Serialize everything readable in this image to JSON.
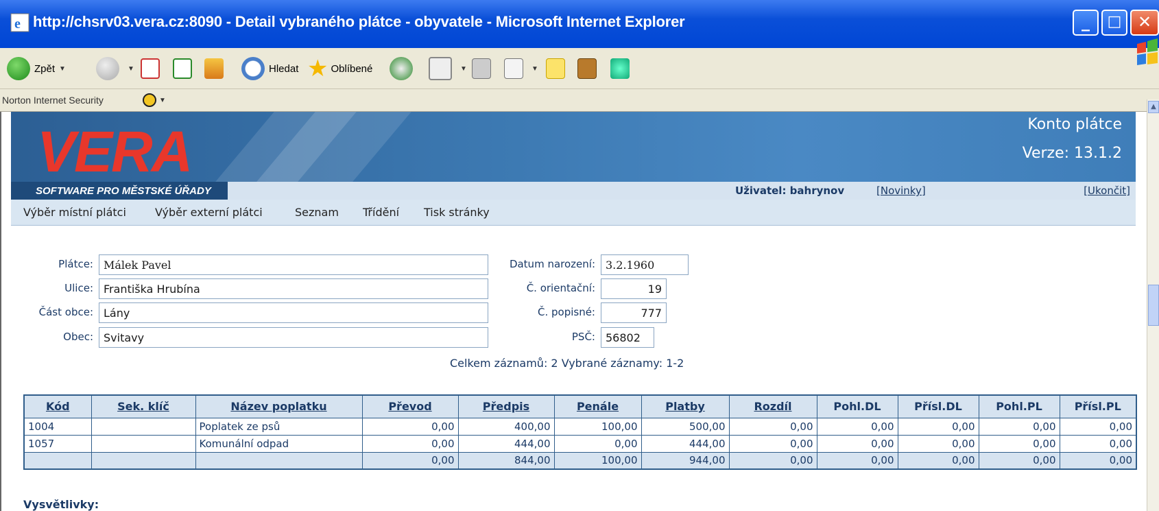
{
  "window": {
    "title": "http://chsrv03.vera.cz:8090 - Detail vybraného plátce - obyvatele - Microsoft Internet Explorer",
    "minimize": "_",
    "maximize": "□",
    "close": "✕"
  },
  "toolbar": {
    "back": "Zpět",
    "search": "Hledat",
    "favorites": "Oblíbené"
  },
  "norton": {
    "label": "Norton Internet Security"
  },
  "header": {
    "logo": "VERA",
    "tagline": "SOFTWARE PRO MĚSTSKÉ ÚŘADY",
    "module": "Konto plátce",
    "version": "Verze: 13.1.2",
    "user": "Uživatel: bahrynov",
    "news": "[Novinky]",
    "logout": "[Ukončit]"
  },
  "menu": [
    "Výběr místní plátci",
    "Výběr externí plátci",
    "Seznam",
    "Třídění",
    "Tisk stránky"
  ],
  "form": {
    "platce_label": "Plátce:",
    "platce": "Málek Pavel",
    "ulice_label": "Ulice:",
    "ulice": "Františka Hrubína",
    "cast_label": "Část obce:",
    "cast": "Lány",
    "obec_label": "Obec:",
    "obec": "Svitavy",
    "datum_label": "Datum narození:",
    "datum": "3.2.1960",
    "orient_label": "Č. orientační:",
    "orient": "19",
    "popis_label": "Č. popisné:",
    "popis": "777",
    "psc_label": "PSČ:",
    "psc": "56802"
  },
  "summary": "Celkem záznamů: 2 Vybrané záznamy: 1-2",
  "table": {
    "headers": [
      "Kód",
      "Sek. klíč",
      "Název poplatku",
      "Převod",
      "Předpis",
      "Penále",
      "Platby",
      "Rozdíl",
      "Pohl.DL",
      "Přísl.DL",
      "Pohl.PL",
      "Přísl.PL"
    ],
    "rows": [
      [
        "1004",
        "",
        "Poplatek ze psů",
        "0,00",
        "400,00",
        "100,00",
        "500,00",
        "0,00",
        "0,00",
        "0,00",
        "0,00",
        "0,00"
      ],
      [
        "1057",
        "",
        "Komunální odpad",
        "0,00",
        "444,00",
        "0,00",
        "444,00",
        "0,00",
        "0,00",
        "0,00",
        "0,00",
        "0,00"
      ],
      [
        "",
        "",
        "",
        "0,00",
        "844,00",
        "100,00",
        "944,00",
        "0,00",
        "0,00",
        "0,00",
        "0,00",
        "0,00"
      ]
    ]
  },
  "explanations_heading": "Vysvětlivky:"
}
